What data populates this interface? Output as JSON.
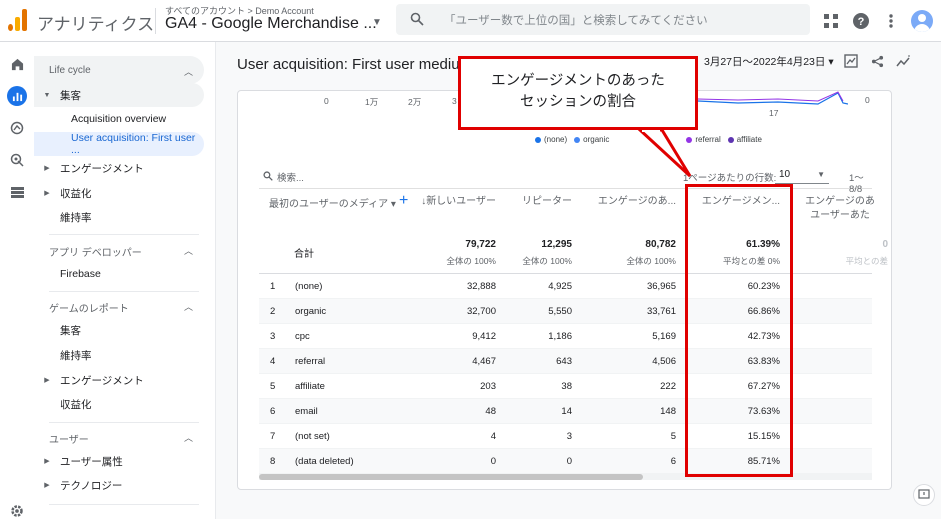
{
  "app": {
    "name": "アナリティクス",
    "breadcrumb": "すべてのアカウント > Demo Account",
    "property": "GA4 - Google Merchandise ..."
  },
  "search": {
    "placeholder": "「ユーザー数で上位の国」と検索してみてください"
  },
  "top_icons": [
    "apps-grid-icon",
    "help-icon",
    "more-vert-icon",
    "account-avatar"
  ],
  "rail": [
    "home-icon",
    "reports-icon",
    "explore-icon",
    "advertising-icon",
    "configure-icon",
    "settings-icon"
  ],
  "sidenav": {
    "lifecycle_label": "Life cycle",
    "acquisition": "集客",
    "acquisition_overview": "Acquisition overview",
    "user_acquisition": "User acquisition: First user ...",
    "engagement": "エンゲージメント",
    "monetization": "収益化",
    "retention": "維持率",
    "app_developer_label": "アプリ デベロッパー",
    "firebase": "Firebase",
    "games_label": "ゲームのレポート",
    "games_acquisition": "集客",
    "games_retention": "維持率",
    "games_engagement": "エンゲージメント",
    "games_monetization": "収益化",
    "user_label": "ユーザー",
    "user_attributes": "ユーザー属性",
    "technology": "テクノロジー"
  },
  "report": {
    "title": "User acquisition: First user mediu",
    "date_range": "3月27日〜2022年4月23日 ▾"
  },
  "chart": {
    "x_ticks": [
      "0",
      "1万",
      "2万",
      "3"
    ],
    "right_tick": "0",
    "date_tick": "17",
    "legend": [
      {
        "name": "(none)",
        "color": "#1a73e8"
      },
      {
        "name": "organic",
        "color": "#4285f4"
      },
      {
        "name": "referral",
        "color": "#9334e6"
      },
      {
        "name": "affiliate",
        "color": "#5e35b1"
      }
    ]
  },
  "table": {
    "search_placeholder": "検索...",
    "rows_per_page_label": "1ページあたりの行数:",
    "rows_per_page": "10",
    "pager": "1～8/8",
    "dimension_header": "最初のユーザーのメディア ▾",
    "columns": [
      {
        "label": "↓新しいユーザー",
        "total": "79,722",
        "sub": "全体の 100%"
      },
      {
        "label": "リピーター",
        "total": "12,295",
        "sub": "全体の 100%"
      },
      {
        "label": "エンゲージのあ...",
        "total": "80,782",
        "sub": "全体の 100%"
      },
      {
        "label": "エンゲージメン...",
        "total": "61.39%",
        "sub": "平均との差 0%"
      },
      {
        "label": "エンゲージのあ\nユーザーあた",
        "total": "0",
        "sub": "平均との差"
      }
    ],
    "total_label": "合計",
    "rows": [
      {
        "i": "1",
        "dim": "(none)",
        "v": [
          "32,888",
          "4,925",
          "36,965",
          "60.23%"
        ]
      },
      {
        "i": "2",
        "dim": "organic",
        "v": [
          "32,700",
          "5,550",
          "33,761",
          "66.86%"
        ]
      },
      {
        "i": "3",
        "dim": "cpc",
        "v": [
          "9,412",
          "1,186",
          "5,169",
          "42.73%"
        ]
      },
      {
        "i": "4",
        "dim": "referral",
        "v": [
          "4,467",
          "643",
          "4,506",
          "63.83%"
        ]
      },
      {
        "i": "5",
        "dim": "affiliate",
        "v": [
          "203",
          "38",
          "222",
          "67.27%"
        ]
      },
      {
        "i": "6",
        "dim": "email",
        "v": [
          "48",
          "14",
          "148",
          "73.63%"
        ]
      },
      {
        "i": "7",
        "dim": "(not set)",
        "v": [
          "4",
          "3",
          "5",
          "15.15%"
        ]
      },
      {
        "i": "8",
        "dim": "(data deleted)",
        "v": [
          "0",
          "0",
          "6",
          "85.71%"
        ]
      }
    ]
  },
  "annotation": {
    "callout_line1": "エンゲージメントのあった",
    "callout_line2": "セッションの割合",
    "color": "#e00000"
  }
}
